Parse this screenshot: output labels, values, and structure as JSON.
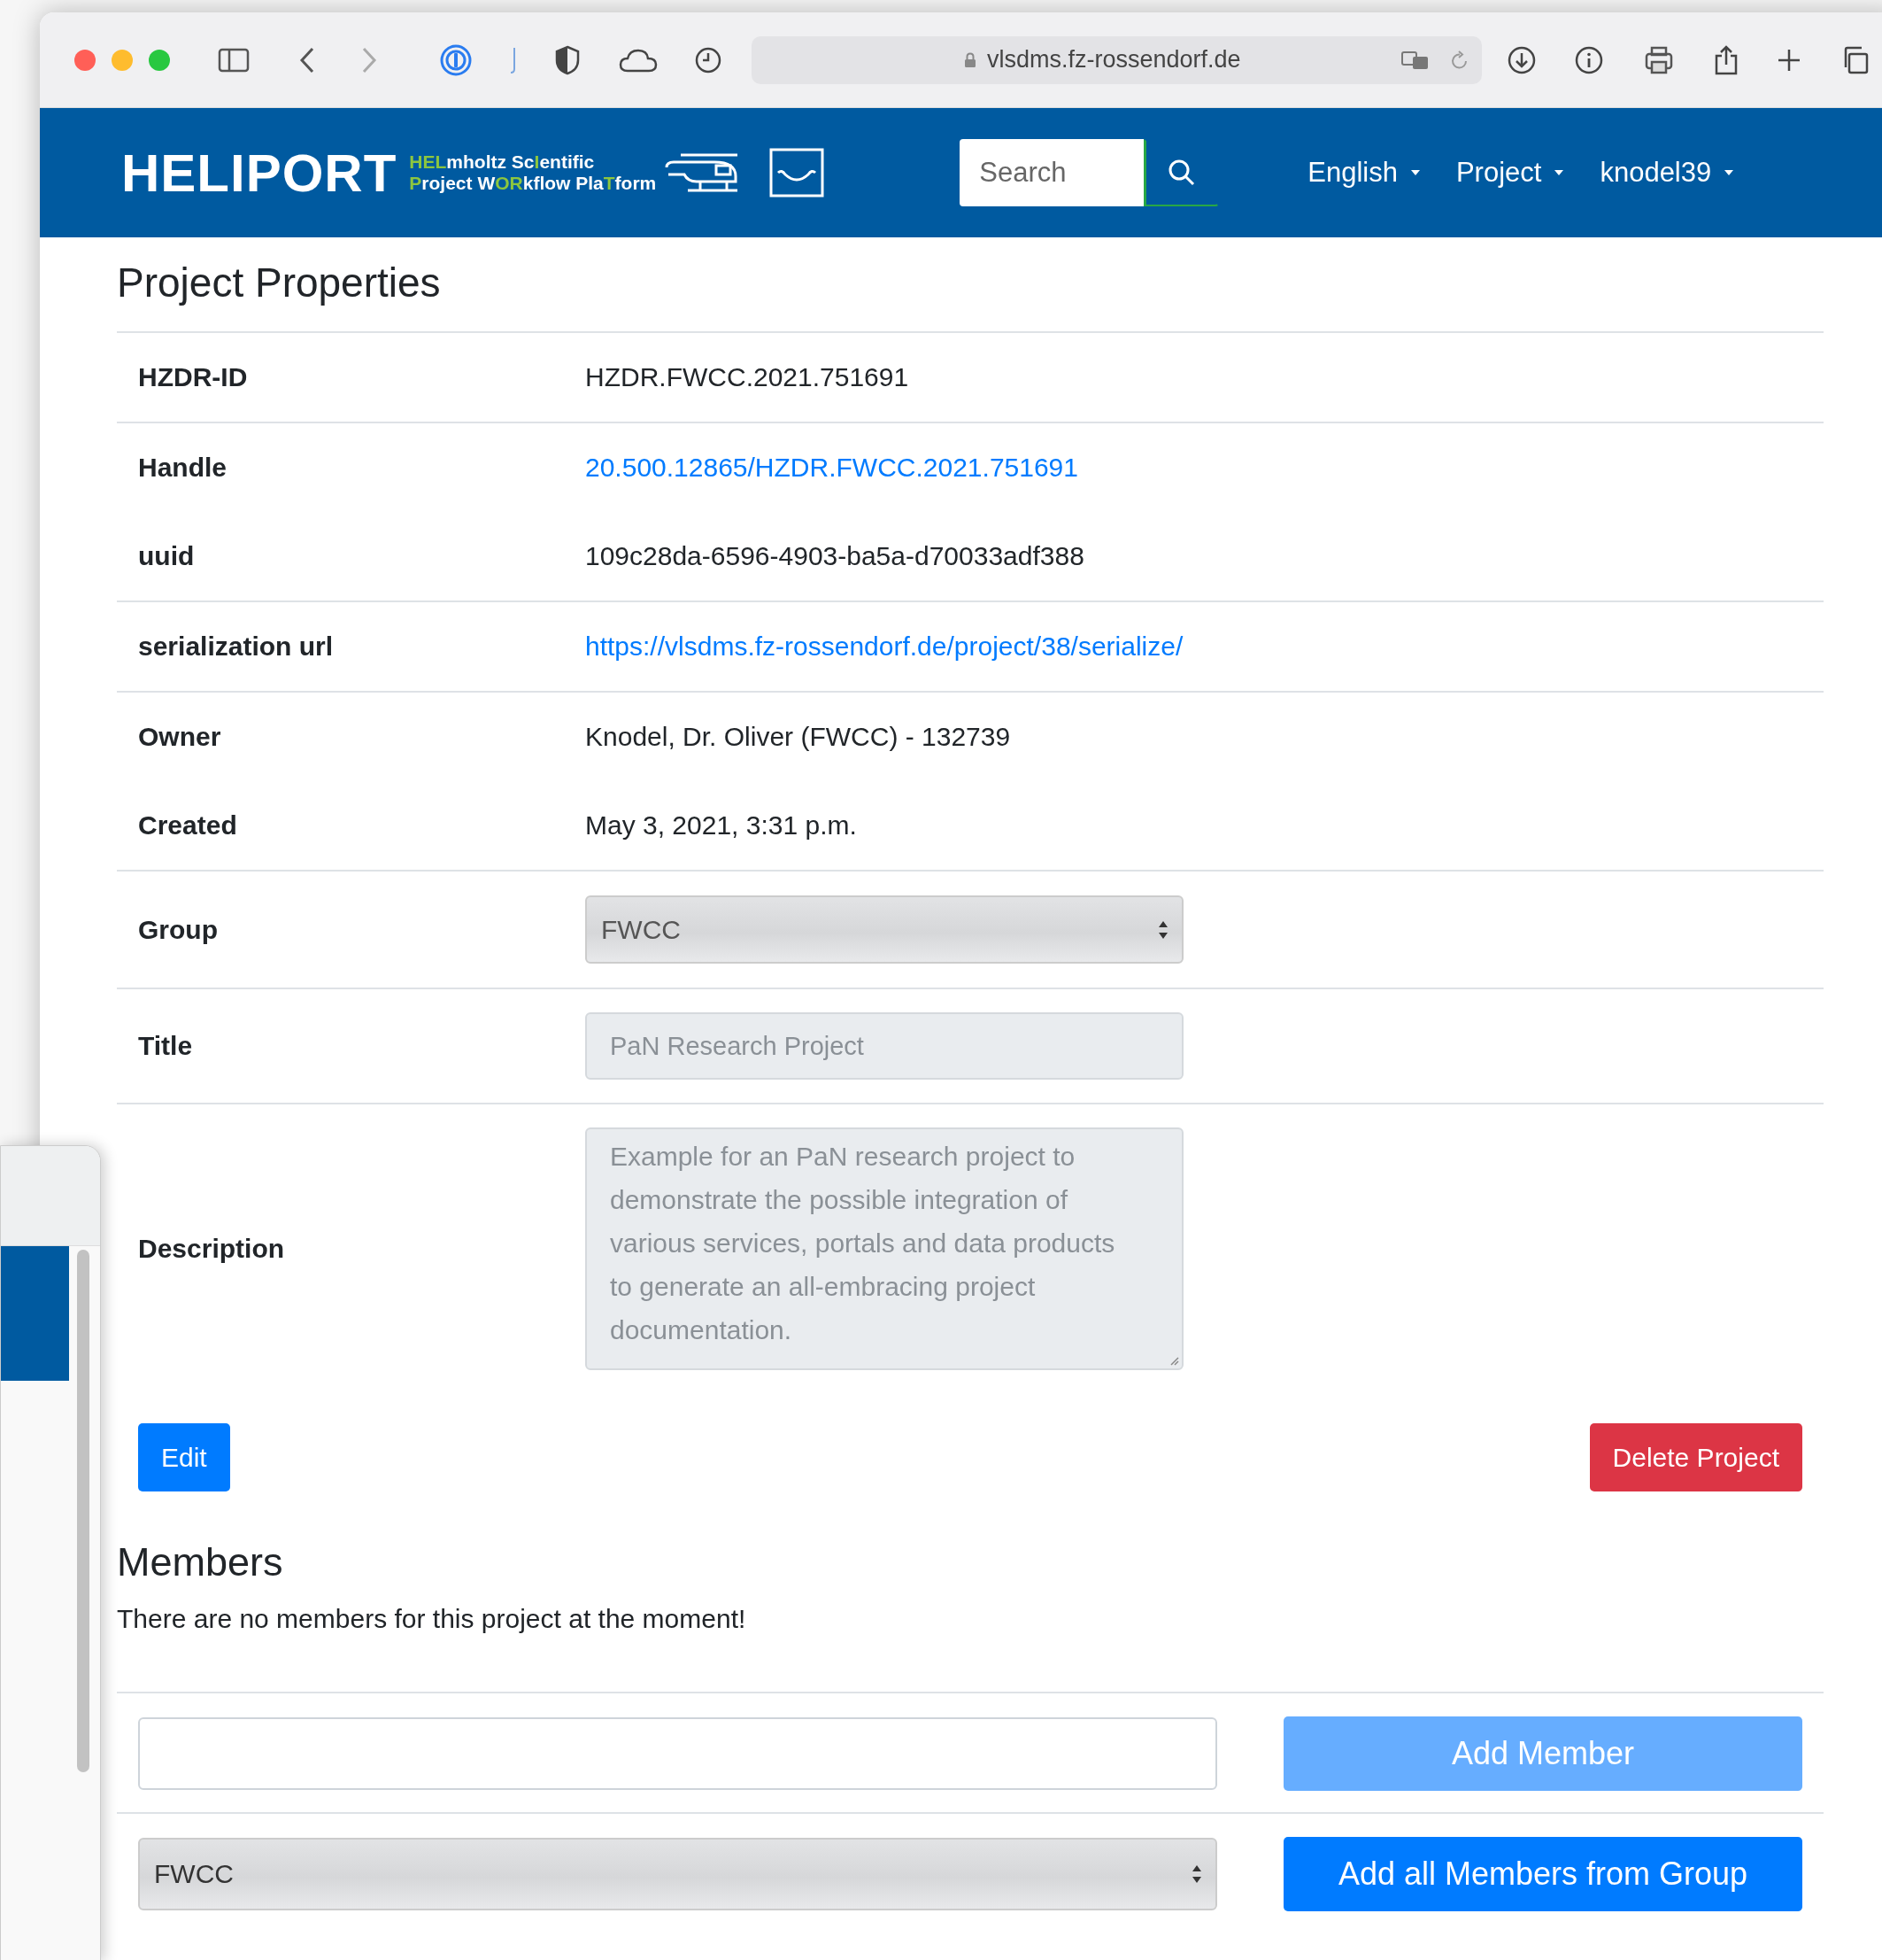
{
  "browser": {
    "url": "vlsdms.fz-rossendorf.de",
    "back": {
      "disabled": false
    },
    "forward": {
      "disabled": true
    }
  },
  "navbar": {
    "brand": "HELIPORT",
    "tagline": [
      [
        {
          "text": "HEL",
          "highlight": true
        },
        {
          "text": "mholtz Sc",
          "highlight": false
        },
        {
          "text": "I",
          "highlight": true
        },
        {
          "text": "entific",
          "highlight": false
        }
      ],
      [
        {
          "text": "P",
          "highlight": true
        },
        {
          "text": "roject W",
          "highlight": false
        },
        {
          "text": "OR",
          "highlight": true
        },
        {
          "text": "kflow Pla",
          "highlight": false
        },
        {
          "text": "T",
          "highlight": true
        },
        {
          "text": "form",
          "highlight": false
        }
      ]
    ],
    "search": {
      "placeholder": "Search"
    },
    "menus": [
      "English",
      "Project",
      "knodel39"
    ]
  },
  "title": "Project Properties",
  "property_groups": [
    {
      "rows": [
        {
          "label": "HZDR-ID",
          "kind": "text",
          "value": "HZDR.FWCC.2021.751691"
        }
      ]
    },
    {
      "rows": [
        {
          "label": "Handle",
          "kind": "link",
          "value": "20.500.12865/HZDR.FWCC.2021.751691"
        },
        {
          "label": "uuid",
          "kind": "text",
          "value": "109c28da-6596-4903-ba5a-d70033adf388"
        }
      ]
    },
    {
      "rows": [
        {
          "label": "serialization url",
          "kind": "link",
          "value": "https://vlsdms.fz-rossendorf.de/project/38/serialize/"
        }
      ]
    },
    {
      "rows": [
        {
          "label": "Owner",
          "kind": "text",
          "value": "Knodel, Dr. Oliver (FWCC) - 132739"
        },
        {
          "label": "Created",
          "kind": "text",
          "value": "May 3, 2021, 3:31 p.m."
        }
      ]
    },
    {
      "rows": [
        {
          "label": "Group",
          "kind": "select",
          "value": "FWCC",
          "disabled": true
        }
      ]
    },
    {
      "rows": [
        {
          "label": "Title",
          "kind": "input",
          "value": "PaN Research Project",
          "disabled": true
        }
      ]
    },
    {
      "rows": [
        {
          "label": "Description",
          "kind": "textarea",
          "value": "Example for an PaN research project to demonstrate the possible integration of various services, portals and data products to generate an all-embracing project documentation.",
          "disabled": true
        }
      ]
    }
  ],
  "actions": [
    {
      "label": "Edit",
      "kind": "primary"
    },
    {
      "label": "Delete Project",
      "kind": "danger"
    }
  ],
  "members": {
    "heading": "Members",
    "message": "There are no members for this project at the moment!",
    "add_member": {
      "label": "Add Member",
      "disabled": true
    },
    "group_select": {
      "value": "FWCC"
    },
    "add_group": {
      "label": "Add all Members from Group",
      "disabled": false
    }
  }
}
